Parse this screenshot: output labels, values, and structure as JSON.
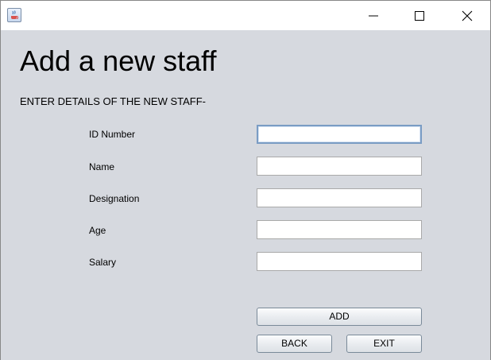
{
  "window": {
    "app_icon": "java-cup-icon",
    "controls": {
      "minimize": "minimize-icon",
      "maximize": "maximize-icon",
      "close": "close-icon"
    }
  },
  "form": {
    "title": "Add a new staff",
    "subtitle": "ENTER DETAILS OF THE NEW STAFF-",
    "fields": [
      {
        "label": "ID Number",
        "value": ""
      },
      {
        "label": "Name",
        "value": ""
      },
      {
        "label": "Designation",
        "value": ""
      },
      {
        "label": "Age",
        "value": ""
      },
      {
        "label": "Salary",
        "value": ""
      }
    ],
    "buttons": {
      "add": "ADD",
      "back": "BACK",
      "exit": "EXIT"
    }
  }
}
